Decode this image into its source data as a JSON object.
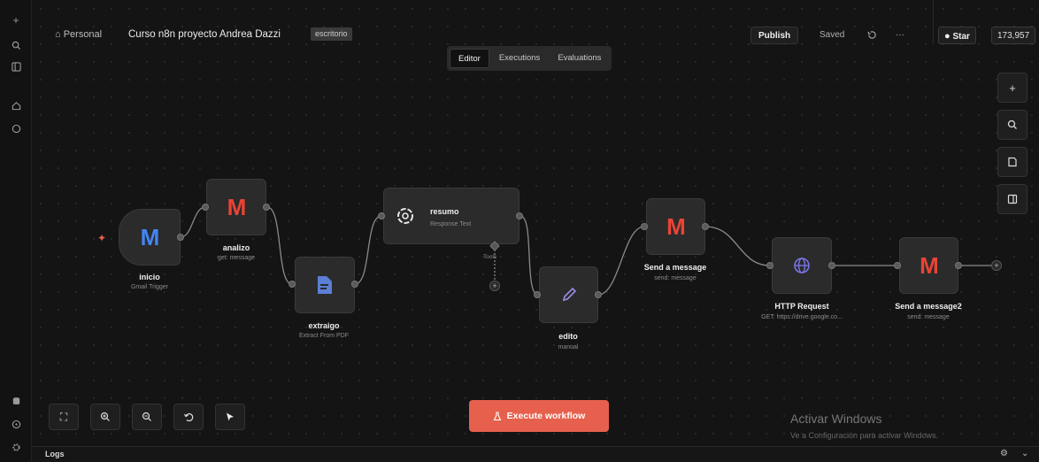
{
  "header": {
    "breadcrumb": "⌂ Personal",
    "workflow_title": "Curso n8n proyecto Andrea Dazzi",
    "tag": "escritorio",
    "publish_label": "Publish",
    "saved_label": "Saved",
    "more_label": "···",
    "star_label": "Star",
    "star_count": "173,957"
  },
  "tabs": [
    {
      "label": "Editor",
      "active": true
    },
    {
      "label": "Executions",
      "active": false
    },
    {
      "label": "Evaluations",
      "active": false
    }
  ],
  "nodes": {
    "inicio": {
      "title": "inicio",
      "subtitle": "Gmail Trigger",
      "icon": "gmail-icon"
    },
    "analizo": {
      "title": "analizo",
      "subtitle": "get: message",
      "icon": "gmail-icon"
    },
    "extraigo": {
      "title": "extraigo",
      "subtitle": "Extract From PDF",
      "icon": "document-icon"
    },
    "resumo": {
      "title": "resumo",
      "subtitle": "Response Text",
      "icon": "openai-icon",
      "tools_label": "Tools"
    },
    "edito": {
      "title": "edito",
      "subtitle": "manual",
      "icon": "pencil-icon"
    },
    "send1": {
      "title": "Send a message",
      "subtitle": "send: message",
      "icon": "gmail-icon"
    },
    "http": {
      "title": "HTTP Request",
      "subtitle": "GET: https://drive.google.co...",
      "icon": "globe-icon"
    },
    "send2": {
      "title": "Send a message2",
      "subtitle": "send: message",
      "icon": "gmail-icon"
    }
  },
  "execute_label": "Execute workflow",
  "logs_label": "Logs",
  "windows_watermark": {
    "title": "Activar Windows",
    "subtitle": "Ve a Configuración para activar Windows."
  },
  "colors": {
    "accent": "#e6604d",
    "canvas_bg": "#141414",
    "node_bg": "#2b2b2b"
  }
}
